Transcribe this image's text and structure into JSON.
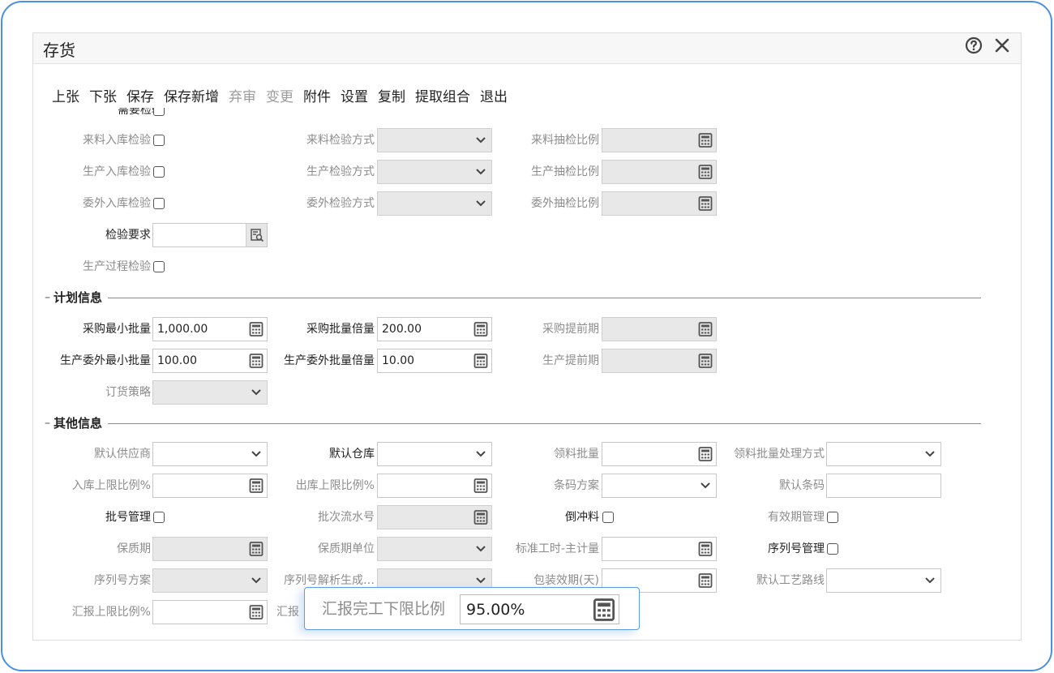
{
  "dialog": {
    "title": "存货",
    "icons": {
      "help": "help-circle-icon",
      "close": "close-icon"
    }
  },
  "toolbar": [
    {
      "label": "上张",
      "enabled": true
    },
    {
      "label": "下张",
      "enabled": true
    },
    {
      "label": "保存",
      "enabled": true
    },
    {
      "label": "保存新增",
      "enabled": true
    },
    {
      "label": "弃审",
      "enabled": false
    },
    {
      "label": "变更",
      "enabled": false
    },
    {
      "label": "附件",
      "enabled": true
    },
    {
      "label": "设置",
      "enabled": true
    },
    {
      "label": "复制",
      "enabled": true
    },
    {
      "label": "提取组合",
      "enabled": true
    },
    {
      "label": "退出",
      "enabled": true
    }
  ],
  "inspection": {
    "partial_top_label": "需要检验",
    "incoming_check": "来料入库检验",
    "incoming_method": "来料检验方式",
    "incoming_ratio": "来料抽检比例",
    "production_check": "生产入库检验",
    "production_method": "生产检验方式",
    "production_ratio": "生产抽检比例",
    "outsource_check": "委外入库检验",
    "outsource_method": "委外检验方式",
    "outsource_ratio": "委外抽检比例",
    "requirement": "检验要求",
    "process_check": "生产过程检验"
  },
  "plan": {
    "section_title": "计划信息",
    "purchase_min_lot": {
      "label": "采购最小批量",
      "value": "1,000.00"
    },
    "purchase_lot_multiple": {
      "label": "采购批量倍量",
      "value": "200.00"
    },
    "purchase_lead": {
      "label": "采购提前期",
      "value": ""
    },
    "outsource_min_lot": {
      "label": "生产委外最小批量",
      "value": "100.00"
    },
    "outsource_lot_multiple": {
      "label": "生产委外批量倍量",
      "value": "10.00"
    },
    "production_lead": {
      "label": "生产提前期",
      "value": ""
    },
    "order_strategy": {
      "label": "订货策略",
      "value": ""
    }
  },
  "other": {
    "section_title": "其他信息",
    "default_supplier": "默认供应商",
    "default_warehouse": "默认仓库",
    "issue_lot": "领料批量",
    "issue_lot_method": "领料批量处理方式",
    "inbound_limit": "入库上限比例%",
    "outbound_limit": "出库上限比例%",
    "barcode_scheme": "条码方案",
    "default_barcode": "默认条码",
    "batch_mgmt": "批号管理",
    "batch_serial": "批次流水号",
    "backflush": "倒冲料",
    "expiry_mgmt": "有效期管理",
    "shelf_life": "保质期",
    "shelf_life_unit": "保质期单位",
    "std_hours": "标准工时-主计量",
    "serial_mgmt": "序列号管理",
    "serial_scheme": "序列号方案",
    "serial_parse": "序列号解析生成…",
    "package_validity": "包装效期(天)",
    "default_route": "默认工艺路线",
    "report_upper": "汇报上限比例%",
    "report_lower_partial": "汇报"
  },
  "popup": {
    "label": "汇报完工下限比例",
    "value": "95.00%"
  },
  "colors": {
    "accent": "#4a90e2",
    "disabled_bg": "#e8e8e8",
    "muted_text": "#8c8c8c"
  }
}
